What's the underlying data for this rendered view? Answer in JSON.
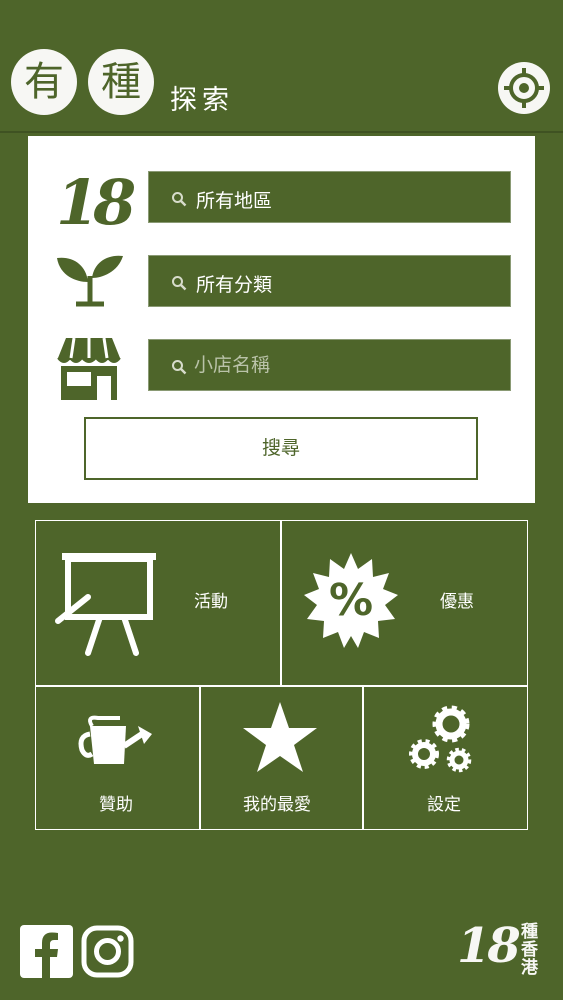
{
  "header": {
    "logo_char_1": "有",
    "logo_char_2": "種",
    "title": "探索",
    "locate_icon": "crosshair-icon"
  },
  "search": {
    "region": {
      "icon": "number-18-icon",
      "value": "所有地區"
    },
    "category": {
      "icon": "sprout-icon",
      "value": "所有分類"
    },
    "shop": {
      "icon": "storefront-icon",
      "placeholder": "小店名稱"
    },
    "submit_label": "搜尋"
  },
  "menu": {
    "events": {
      "icon": "presentation-board-icon",
      "label": "活動"
    },
    "offers": {
      "icon": "percent-badge-icon",
      "label": "優惠"
    },
    "sponsor": {
      "icon": "watering-can-icon",
      "label": "贊助"
    },
    "favorites": {
      "icon": "star-icon",
      "label": "我的最愛"
    },
    "settings": {
      "icon": "gears-icon",
      "label": "設定"
    }
  },
  "footer": {
    "facebook_icon": "facebook-icon",
    "instagram_icon": "instagram-icon",
    "brand_number": "18",
    "brand_text": "種香港"
  },
  "colors": {
    "primary_green": "#4e652a",
    "panel_white": "#ffffff",
    "logo_cream": "#f7f7f4"
  }
}
